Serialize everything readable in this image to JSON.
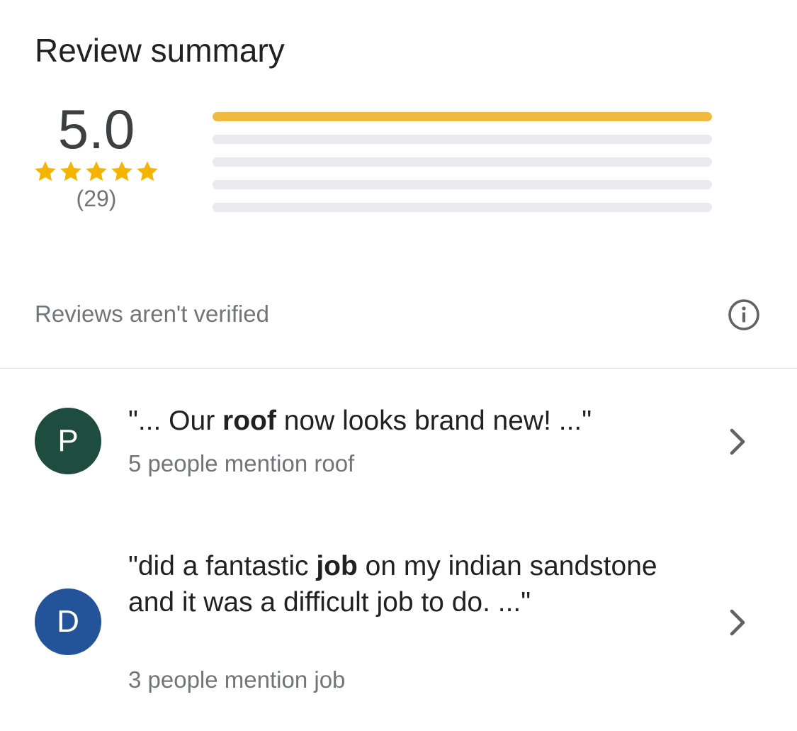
{
  "summary": {
    "title": "Review summary",
    "average_rating": "5.0",
    "review_count": "(29)",
    "star_count": 5,
    "star_color": "#F4B400",
    "distribution": [
      {
        "stars": 5,
        "fraction": 1.0
      },
      {
        "stars": 4,
        "fraction": 0.0
      },
      {
        "stars": 3,
        "fraction": 0.0
      },
      {
        "stars": 2,
        "fraction": 0.0
      },
      {
        "stars": 1,
        "fraction": 0.0
      }
    ],
    "bar_fill_color": "#F0B940",
    "bar_track_color": "#E8EAED"
  },
  "notice": {
    "text": "Reviews aren't verified",
    "icon": "info-icon"
  },
  "topics": [
    {
      "avatar_letter": "P",
      "avatar_color": "#1E4D3F",
      "quote_before": "\"... Our ",
      "quote_keyword": "roof",
      "quote_after": " now looks brand new! ...\"",
      "mention": "5 people mention roof",
      "icon": "chevron-right-icon"
    },
    {
      "avatar_letter": "D",
      "avatar_color": "#23549A",
      "quote_before": "\"did a fantastic ",
      "quote_keyword": "job",
      "quote_after": " on my indian sandstone and it was a difficult job to do. ...\"",
      "mention": "3 people mention job",
      "icon": "chevron-right-icon"
    }
  ]
}
